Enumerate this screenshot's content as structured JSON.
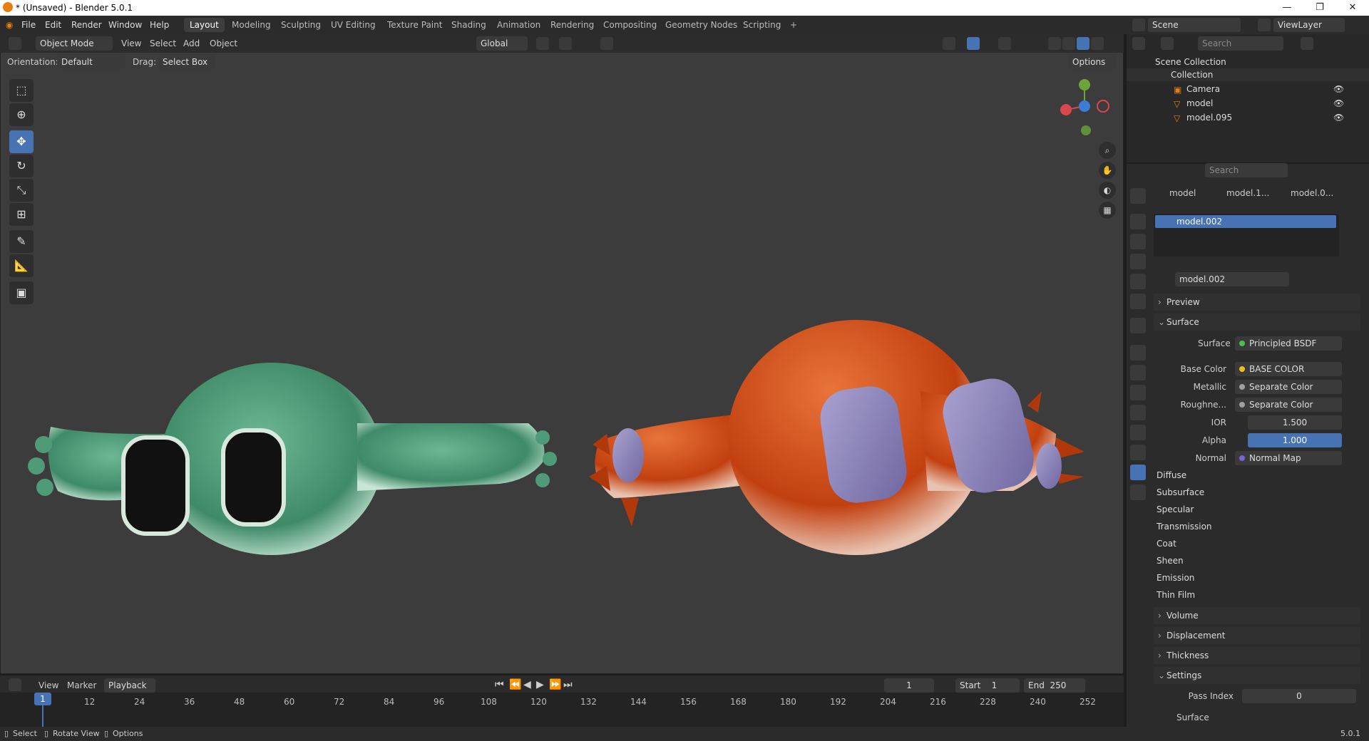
{
  "window": {
    "title": "* (Unsaved) - Blender 5.0.1"
  },
  "menu": [
    "File",
    "Edit",
    "Render",
    "Window",
    "Help"
  ],
  "workspaces": [
    "Layout",
    "Modeling",
    "Sculpting",
    "UV Editing",
    "Texture Paint",
    "Shading",
    "Animation",
    "Rendering",
    "Compositing",
    "Geometry Nodes",
    "Scripting"
  ],
  "scene": {
    "label": "Scene",
    "viewlayer": "ViewLayer"
  },
  "viewport": {
    "mode": "Object Mode",
    "menus": [
      "View",
      "Select",
      "Add",
      "Object"
    ],
    "transform_orientation": "Global",
    "orientation_label": "Orientation:",
    "orientation_value": "Default",
    "drag_label": "Drag:",
    "drag_value": "Select Box",
    "options": "Options"
  },
  "outliner": {
    "search_placeholder": "Search",
    "root": "Scene Collection",
    "collection": "Collection",
    "items": [
      "Camera",
      "model",
      "model.095"
    ]
  },
  "properties": {
    "search_placeholder": "Search",
    "breadcrumb": [
      "model",
      "model.1...",
      "model.0..."
    ],
    "slot": "model.002",
    "material_name": "model.002",
    "sections": {
      "preview": "Preview",
      "surface": "Surface",
      "volume": "Volume",
      "displacement": "Displacement",
      "thickness": "Thickness",
      "settings": "Settings",
      "surface_sub": "Surface"
    },
    "surface_label": "Surface",
    "surface_value": "Principled BSDF",
    "inputs": [
      {
        "label": "Base Color",
        "value": "BASE COLOR",
        "dot": "#e6c21a"
      },
      {
        "label": "Metallic",
        "value": "Separate Color",
        "dot": "#a0a0a0"
      },
      {
        "label": "Roughne...",
        "value": "Separate Color",
        "dot": "#a0a0a0"
      }
    ],
    "ior_label": "IOR",
    "ior_value": "1.500",
    "alpha_label": "Alpha",
    "alpha_value": "1.000",
    "normal_label": "Normal",
    "normal_value": "Normal Map",
    "subpanels": [
      "Diffuse",
      "Subsurface",
      "Specular",
      "Transmission",
      "Coat",
      "Sheen",
      "Emission",
      "Thin Film"
    ],
    "pass_index_label": "Pass Index",
    "pass_index_value": "0"
  },
  "timeline": {
    "menus": [
      "View",
      "Marker",
      "Playback"
    ],
    "current_frame": "1",
    "start_label": "Start",
    "start": "1",
    "end_label": "End",
    "end": "250",
    "ruler": [
      "1",
      "12",
      "24",
      "36",
      "48",
      "60",
      "72",
      "84",
      "96",
      "108",
      "120",
      "132",
      "144",
      "156",
      "168",
      "180",
      "192",
      "204",
      "216",
      "228",
      "240",
      "252"
    ]
  },
  "statusbar": {
    "items": [
      "Select",
      "Rotate View",
      "Options"
    ],
    "version": "5.0.1"
  },
  "colors": {
    "accent": "#4772b3",
    "green_model": "#4f9a78",
    "orange_model": "#d2471a",
    "lilac": "#8c84b8"
  }
}
